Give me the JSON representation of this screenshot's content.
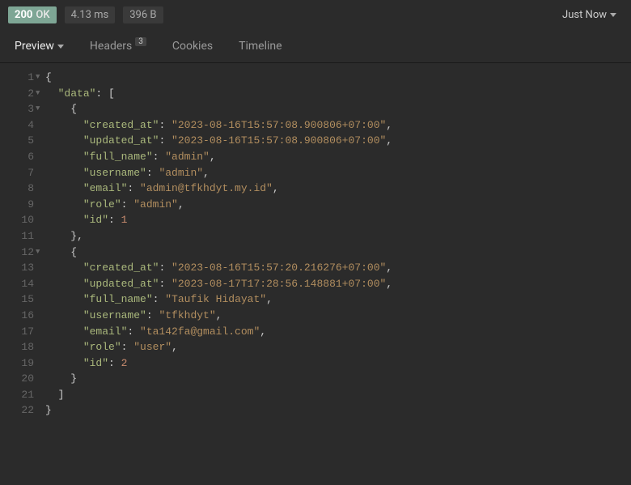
{
  "topbar": {
    "status_code": "200",
    "status_text": "OK",
    "time": "4.13 ms",
    "size": "396 B",
    "timestamp": "Just Now"
  },
  "tabs": {
    "preview": "Preview",
    "headers": "Headers",
    "headers_count": "3",
    "cookies": "Cookies",
    "timeline": "Timeline"
  },
  "response": {
    "data": [
      {
        "created_at": "2023-08-16T15:57:08.900806+07:00",
        "updated_at": "2023-08-16T15:57:08.900806+07:00",
        "full_name": "admin",
        "username": "admin",
        "email": "admin@tfkhdyt.my.id",
        "role": "admin",
        "id": 1
      },
      {
        "created_at": "2023-08-16T15:57:20.216276+07:00",
        "updated_at": "2023-08-17T17:28:56.148881+07:00",
        "full_name": "Taufik Hidayat",
        "username": "tfkhdyt",
        "email": "ta142fa@gmail.com",
        "role": "user",
        "id": 2
      }
    ]
  }
}
